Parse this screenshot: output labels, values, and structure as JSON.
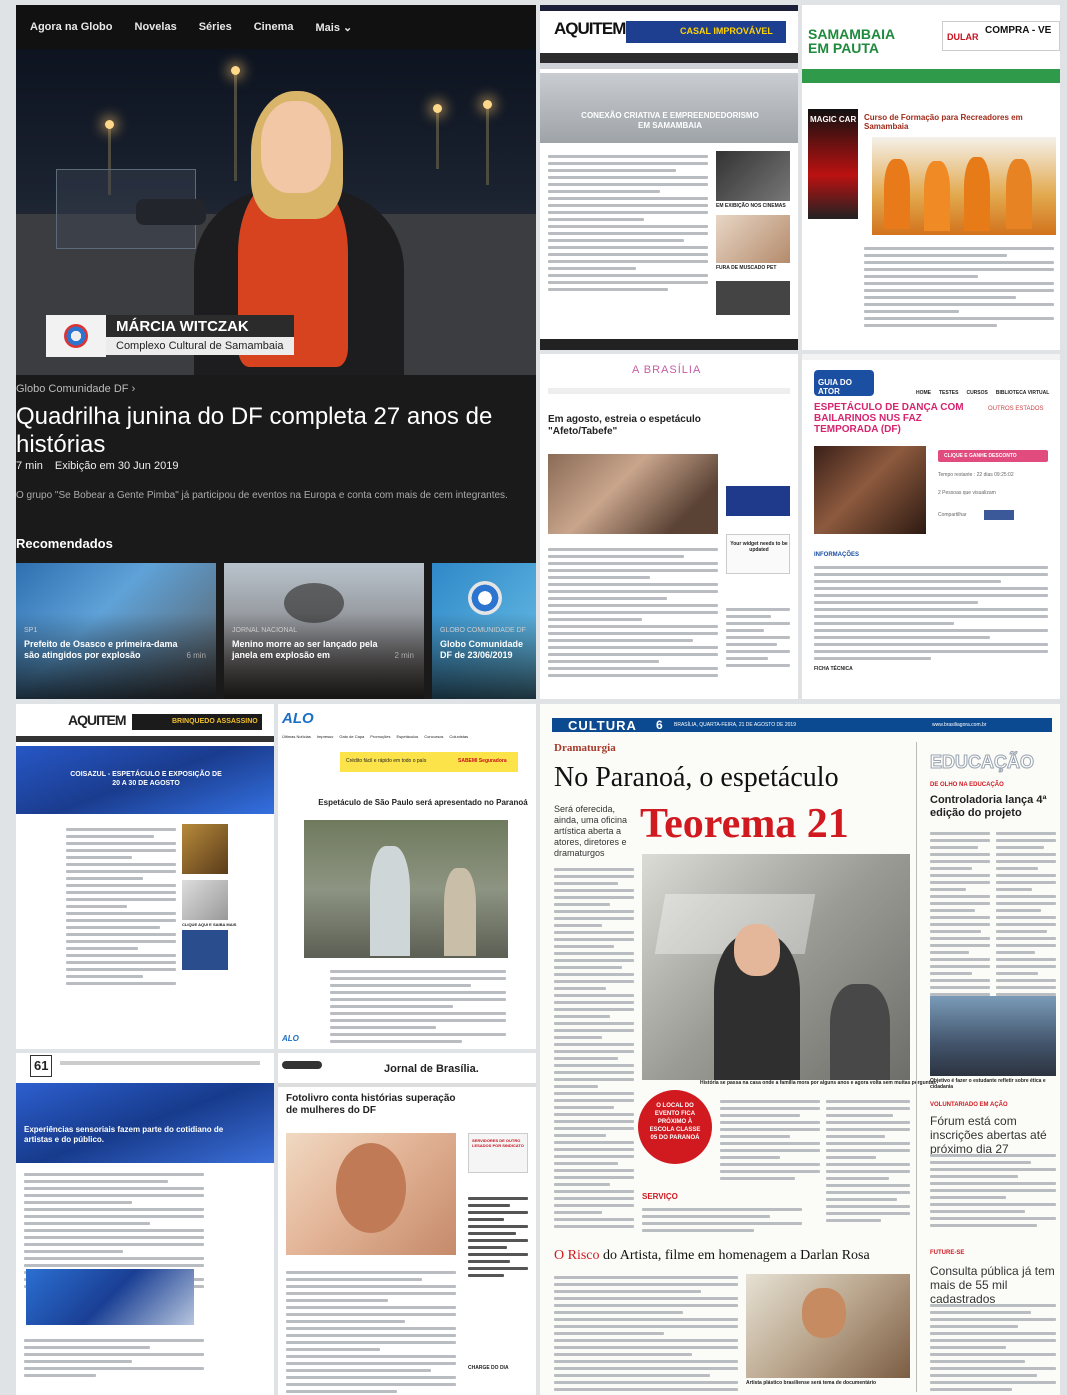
{
  "globo": {
    "nav": [
      "Agora na Globo",
      "Novelas",
      "Séries",
      "Cinema",
      "Mais"
    ],
    "caption_name": "MÁRCIA WITCZAK",
    "caption_place": "Complexo Cultural de Samambaia",
    "breadcrumb": "Globo Comunidade DF",
    "title": "Quadrilha junina do DF completa 27 anos de histórias",
    "duration": "7 min",
    "aired": "Exibição em 30 Jun 2019",
    "description": "O grupo \"Se Bobear a Gente Pimba\" já participou de eventos na Europa e conta com mais de cem integrantes.",
    "recommended_heading": "Recomendados",
    "thumbs": [
      {
        "category": "SP1",
        "title": "Prefeito de Osasco e primeira-dama são atingidos por explosão",
        "duration": "6 min"
      },
      {
        "category": "JORNAL NACIONAL",
        "title": "Menino morre ao ser lançado pela janela em explosão em",
        "duration": "2 min"
      },
      {
        "category": "GLOBO COMUNIDADE DF",
        "title": "Globo Comunidade DF de 23/06/2019",
        "duration": ""
      }
    ],
    "colors": {
      "bg": "#1a1a1a",
      "accent": "#d8431f"
    }
  },
  "aqui_top": {
    "masthead": "AQUITEM",
    "banner": "CASAL IMPROVÁVEL",
    "headline": "CONEXÃO CRIATIVA E EMPREENDEDORISMO EM SAMAMBAIA",
    "side_labels": [
      "EM EXIBIÇÃO NOS CINEMAS",
      "FURA DE MUSCADO PET"
    ]
  },
  "samambaia": {
    "masthead": "SAMAMBAIA EM PAUTA",
    "ad_brand": "DULAR",
    "ad_text": "COMPRA - VE",
    "side_ad": "MAGIC CAR",
    "headline": "Curso de Formação para Recreadores em Samambaia"
  },
  "abrasilia": {
    "masthead": "A BRASÍLIA",
    "headline": "Em agosto, estreia o espetáculo \"Afeto/Tabefe\"",
    "widget_note": "Your widget needs to be updated"
  },
  "guia_ator": {
    "masthead": "GUIA DO ATOR",
    "nav": [
      "HOME",
      "TESTES",
      "CURSOS",
      "BIBLIOTECA VIRTUAL"
    ],
    "headline": "ESPETÁCULO DE DANÇA COM BAILARINOS NUS FAZ TEMPORADA (DF)",
    "tag": "OUTROS ESTADOS",
    "cta": "CLIQUE E GANHE DESCONTO",
    "time_left": "Tempo restante : 22 dias 09:25:02",
    "viewers": "2 Pessoas que visualizam",
    "share": "Compartilhar",
    "section": "INFORMAÇÕES",
    "tech_sheet": "FICHA TÉCNICA"
  },
  "aqui_bottom": {
    "masthead": "AQUITEM",
    "banner": "BRINQUEDO ASSASSINO",
    "headline": "COISAZUL - ESPETÁCULO E EXPOSIÇÃO DE 20 A 30 DE AGOSTO",
    "side_label": "CLIQUE AQUI E SAIBA MAIS"
  },
  "alo": {
    "masthead": "ALO",
    "nav": [
      "Últimas Notícias",
      "Impresso",
      "Gato de Capa",
      "Promoções",
      "Espetáculos",
      "Concursos",
      "Colunistas"
    ],
    "ad": "Crédito fácil e rápido em todo o país",
    "ad_brand": "SABEMI Seguradora",
    "headline": "Espetáculo de São Paulo será apresentado no Paranoá",
    "footer_logo": "ALO"
  },
  "sixone": {
    "masthead": "61",
    "headline": "Experiências sensoriais fazem parte do cotidiano de artistas e do público."
  },
  "jornal_brasilia": {
    "masthead": "Jornal de Brasília.",
    "headline": "Fotolivro conta histórias superação de mulheres do DF",
    "side_label": "SERVIDORES DE OUTRO LESADOS POR SINDICATO",
    "charge": "CHARGE DO DIA"
  },
  "cultura": {
    "section": "CULTURA",
    "page_no": "6",
    "date_line": "BRASÍLIA, QUARTA-FEIRA, 21 DE AGOSTO DE 2019",
    "site": "www.brasiliagora.com.br",
    "kicker": "Dramaturgia",
    "headline_1": "No Paranoá, o espetáculo",
    "headline_2": "Teorema 21",
    "standfirst": "Será oferecida, ainda, uma oficina artística aberta a atores, diretores e dramaturgos",
    "photo_caption": "História se passa na casa onde a família mora por alguns anos e agora volta sem muitas perguntas",
    "badge": "O LOCAL DO EVENTO FICA PRÓXIMO À ESCOLA CLASSE 05 DO PARANOÁ",
    "servico": "SERVIÇO",
    "second_head_red": "O Risco",
    "second_head": "do Artista, filme em homenagem a Darlan Rosa",
    "second_caption": "Artista plástico brasiliense será tema de documentário",
    "side_section": "EDUCAÇÃO",
    "side_kicker": "DE OLHO NA EDUCAÇÃO",
    "side_head": "Controladoria lança 4ª edição do projeto",
    "side_caption": "Objetivo é fazer o estudante refletir sobre ética e cidadania",
    "side_kicker_2": "VOLUNTARIADO EM AÇÃO",
    "side_head_2": "Fórum está com inscrições abertas até próximo dia 27",
    "side_kicker_3": "FUTURE-SE",
    "side_head_3": "Consulta pública já tem mais de 55 mil cadastrados"
  }
}
